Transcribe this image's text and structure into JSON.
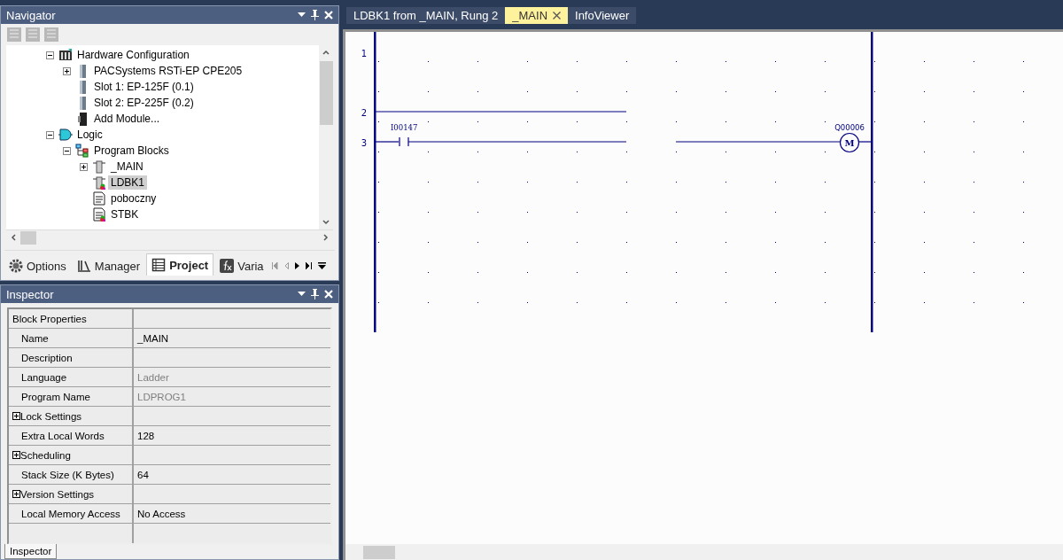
{
  "navigator": {
    "title": "Navigator",
    "tree": [
      {
        "label": "Hardware Configuration",
        "kind": "rack",
        "expanded": true,
        "selected": false,
        "children": [
          {
            "label": "PACSystems RSTi-EP CPE205",
            "kind": "module",
            "expanded": false,
            "selected": false
          },
          {
            "label": "Slot 1:  EP-125F  (0.1)",
            "kind": "module",
            "selected": false
          },
          {
            "label": "Slot 2:  EP-225F  (0.2)",
            "kind": "module",
            "selected": false
          },
          {
            "label": "Add Module...",
            "kind": "add-module",
            "selected": false
          }
        ]
      },
      {
        "label": "Logic",
        "kind": "logic",
        "expanded": true,
        "selected": false,
        "children": [
          {
            "label": "Program Blocks",
            "kind": "blocks",
            "expanded": true,
            "selected": false,
            "children": [
              {
                "label": "_MAIN",
                "kind": "block",
                "expanded": false,
                "selected": false
              },
              {
                "label": "LDBK1",
                "kind": "block-flag",
                "selected": true
              },
              {
                "label": "poboczny",
                "kind": "doc",
                "selected": false
              },
              {
                "label": "STBK",
                "kind": "doc-flag",
                "selected": false
              }
            ]
          }
        ]
      }
    ],
    "tabs": [
      {
        "label": "Options",
        "kind": "gear",
        "selected": false
      },
      {
        "label": "Manager",
        "kind": "books",
        "selected": false
      },
      {
        "label": "Project",
        "kind": "list",
        "selected": true
      },
      {
        "label": "Varia",
        "kind": "fx",
        "selected": false
      }
    ]
  },
  "inspector": {
    "title": "Inspector",
    "rows": [
      {
        "kind": "header",
        "label": "Block Properties"
      },
      {
        "kind": "property",
        "label": "Name",
        "value": "_MAIN",
        "dimmed": false
      },
      {
        "kind": "property",
        "label": "Description"
      },
      {
        "kind": "property",
        "label": "Language",
        "value": "Ladder",
        "dimmed": true
      },
      {
        "kind": "property",
        "label": "Program Name",
        "value": "LDPROG1",
        "dimmed": true
      },
      {
        "kind": "group",
        "label": "Lock Settings",
        "expanded": false
      },
      {
        "kind": "property",
        "label": "Extra Local Words",
        "value": "128",
        "dimmed": false
      },
      {
        "kind": "group",
        "label": "Scheduling",
        "expanded": false
      },
      {
        "kind": "property",
        "label": "Stack Size (K Bytes)",
        "value": "64",
        "dimmed": false
      },
      {
        "kind": "group",
        "label": "Version Settings",
        "expanded": false
      },
      {
        "kind": "property",
        "label": "Local Memory Access",
        "value": "No Access",
        "dimmed": false
      },
      {
        "kind": "empty"
      }
    ],
    "tab": "Inspector"
  },
  "editor": {
    "tabs": [
      {
        "label": "LDBK1 from _MAIN, Rung 2",
        "selected": false
      },
      {
        "label": "_MAIN",
        "selected": true
      },
      {
        "label": "InfoViewer",
        "selected": false
      }
    ],
    "ladder": {
      "rungs": [
        {
          "number": "1"
        },
        {
          "number": "2"
        },
        {
          "number": "3"
        }
      ],
      "contact": {
        "address": "I00147"
      },
      "coil": {
        "address": "Q00006",
        "symbol": "M"
      }
    }
  }
}
